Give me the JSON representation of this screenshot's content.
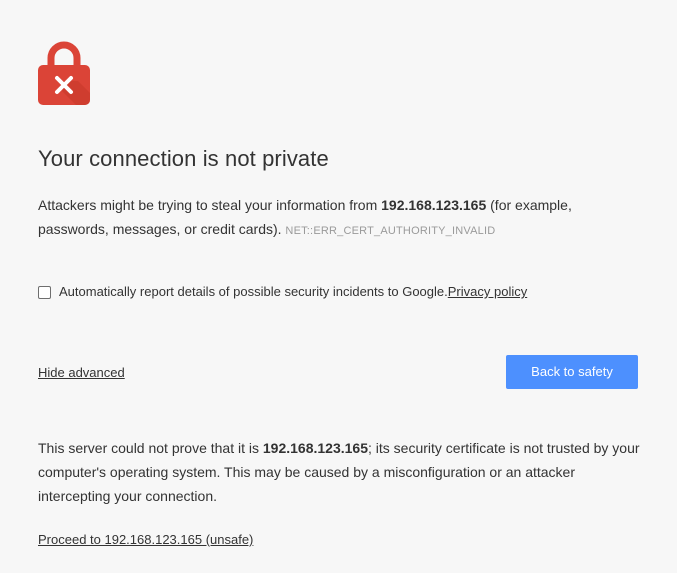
{
  "colors": {
    "background": "#f7f7f7",
    "lock_red": "#db4437",
    "button_blue": "#4d90fe",
    "text": "#333333",
    "error_code_gray": "#9a9a9a"
  },
  "icon": {
    "name": "lock-error-icon"
  },
  "title": "Your connection is not private",
  "main_message": {
    "prefix": "Attackers might be trying to steal your information from ",
    "host": "192.168.123.165",
    "suffix": " (for example, passwords, messages, or credit cards). ",
    "error_code": "NET::ERR_CERT_AUTHORITY_INVALID"
  },
  "report": {
    "checked": false,
    "label": "Automatically report details of possible security incidents to Google. ",
    "privacy_link": "Privacy policy"
  },
  "actions": {
    "hide_advanced": "Hide advanced",
    "back_to_safety": "Back to safety"
  },
  "details": {
    "prefix": "This server could not prove that it is ",
    "host": "192.168.123.165",
    "suffix": "; its security certificate is not trusted by your computer's operating system. This may be caused by a misconfiguration or an attacker intercepting your connection."
  },
  "proceed_link": "Proceed to 192.168.123.165 (unsafe)"
}
